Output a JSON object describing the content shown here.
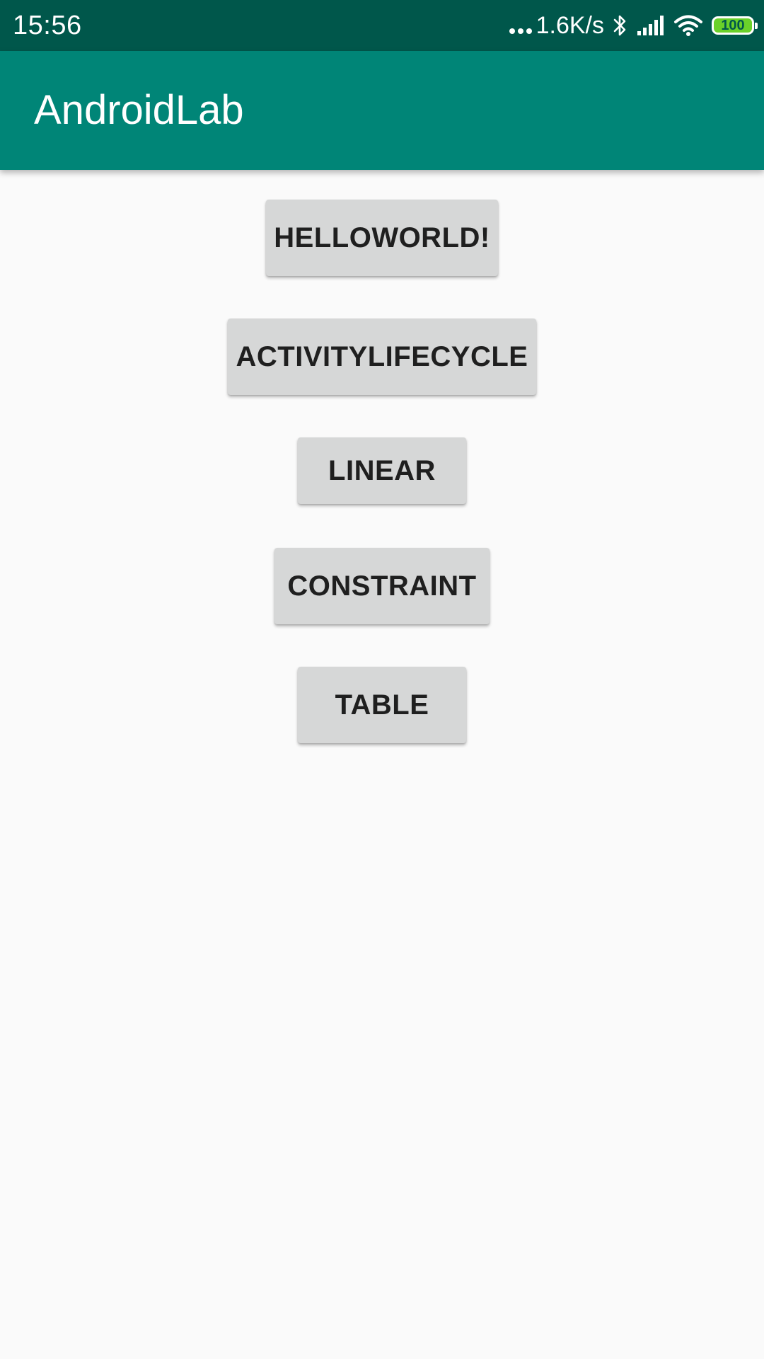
{
  "status_bar": {
    "time": "15:56",
    "net_speed": "1.6K/s",
    "battery_level": "100",
    "icons": [
      "network-activity-dots-icon",
      "bluetooth-icon",
      "signal-icon",
      "wifi-icon",
      "battery-icon"
    ],
    "background_color": "#00574b",
    "battery_color": "#6ad12a"
  },
  "app_bar": {
    "title": "AndroidLab",
    "background_color": "#008577"
  },
  "buttons": [
    {
      "label": "HELLOWORLD!"
    },
    {
      "label": "ACTIVITYLIFECYCLE"
    },
    {
      "label": "LINEAR"
    },
    {
      "label": "CONSTRAINT"
    },
    {
      "label": "TABLE"
    }
  ]
}
